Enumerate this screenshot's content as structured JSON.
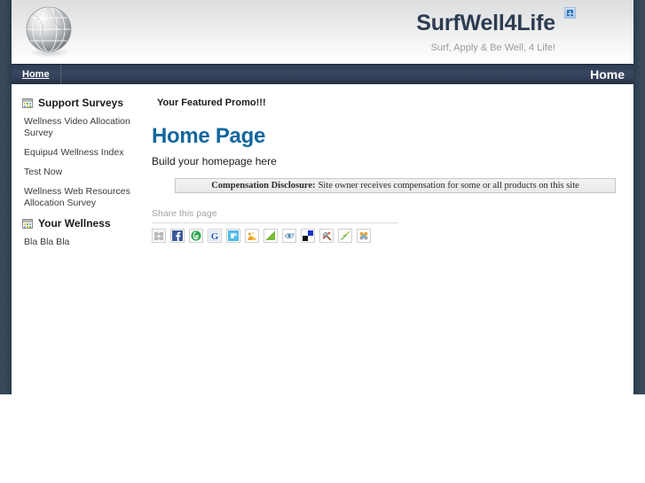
{
  "header": {
    "logo_icon": "globe-icon",
    "title": "SurfWell4Life",
    "tagline": "Surf, Apply & Be Well, 4 Life!",
    "broken_image_icon": "broken-image-icon",
    "bg_start": "#dedede",
    "bg_end": "#ffffff",
    "title_color": "#2d3c52",
    "tagline_color": "#9a9a9a"
  },
  "nav": {
    "bg_color": "#333f57",
    "left_items": [
      {
        "label": "Home"
      }
    ],
    "right_items": [
      {
        "label": "Home"
      }
    ]
  },
  "sidebar": {
    "groups": [
      {
        "icon": "grid-icon",
        "title": "Support Surveys",
        "links": [
          {
            "label": "Wellness Video Allocation Survey"
          },
          {
            "label": "Equipu4 Wellness Index"
          },
          {
            "label": "Test Now"
          },
          {
            "label": "Wellness Web Resources Allocation Survey"
          }
        ]
      },
      {
        "icon": "grid-icon",
        "title": "Your Wellness",
        "links": [
          {
            "label": "Bla Bla Bla"
          }
        ]
      }
    ]
  },
  "main": {
    "promo": "Your Featured Promo!!!",
    "page_title": "Home Page",
    "page_subtitle": "Build your homepage here",
    "title_color": "#14679e",
    "disclosure": {
      "label": "Compensation Disclosure:",
      "text": "Site owner receives compensation for some or all products on this site"
    },
    "share": {
      "label": "Share this page",
      "buttons": [
        {
          "name": "addthis-icon",
          "title": "AddThis"
        },
        {
          "name": "facebook-icon",
          "title": "Facebook"
        },
        {
          "name": "stumbleupon-icon",
          "title": "StumbleUpon"
        },
        {
          "name": "google-icon",
          "title": "Google"
        },
        {
          "name": "twitter-icon",
          "title": "Twitter"
        },
        {
          "name": "myspace-icon",
          "title": "MySpace"
        },
        {
          "name": "yahoo-buzz-icon",
          "title": "Yahoo! Buzz"
        },
        {
          "name": "technorati-icon",
          "title": "Technorati"
        },
        {
          "name": "delicious-icon",
          "title": "Delicious"
        },
        {
          "name": "digg-icon",
          "title": "Digg"
        },
        {
          "name": "newsvine-icon",
          "title": "Newsvine"
        },
        {
          "name": "mixx-icon",
          "title": "Mixx"
        }
      ]
    }
  },
  "frame": {
    "rail_color": "#36485a",
    "page_bg": "#ffffff"
  }
}
